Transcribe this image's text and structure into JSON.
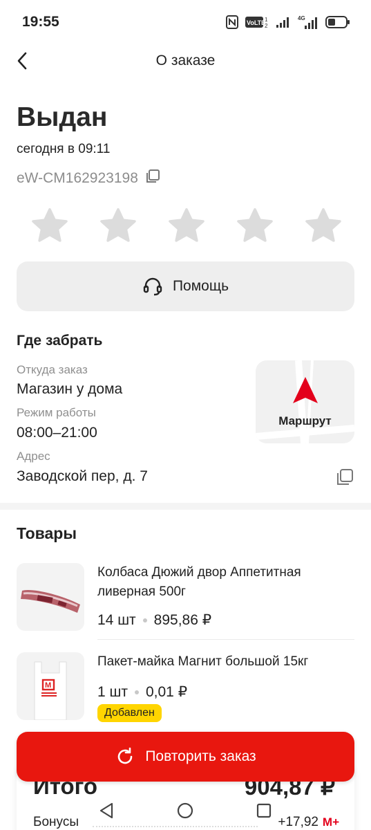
{
  "status_bar": {
    "time": "19:55",
    "icons": [
      "nfc-icon",
      "volte-icon",
      "signal-icon",
      "4g-signal-icon",
      "battery-icon"
    ],
    "volte_text": "VoLTE",
    "network_text": "4G"
  },
  "header": {
    "title": "О заказе",
    "back_icon": "chevron-left-icon"
  },
  "order": {
    "status": "Выдан",
    "date": "сегодня в 09:11",
    "number": "eW-CM162923198",
    "rating_stars": 5,
    "rating_value": 0
  },
  "help": {
    "label": "Помощь",
    "icon": "headset-icon"
  },
  "pickup": {
    "title": "Где забрать",
    "from_label": "Откуда заказ",
    "from_value": "Магазин у дома",
    "hours_label": "Режим работы",
    "hours_value": "08:00–21:00",
    "address_label": "Адрес",
    "address_value": "Заводской пер, д. 7",
    "route_label": "Маршрут"
  },
  "products": {
    "title": "Товары",
    "items": [
      {
        "name": "Колбаса Дюжий двор Аппетитная ливерная 500г",
        "qty": "14 шт",
        "price": "895,86 ₽"
      },
      {
        "name": "Пакет-майка Магнит большой 15кг",
        "qty": "1 шт",
        "price": "0,01 ₽",
        "badge": "Добавлен"
      }
    ]
  },
  "repeat_button": {
    "label": "Повторить заказ",
    "icon": "refresh-icon"
  },
  "total": {
    "label": "Итого",
    "value": "904,87 ₽",
    "bonus_label": "Бонусы",
    "bonus_value": "+17,92",
    "bonus_icon_text": "М+"
  },
  "colors": {
    "accent": "#e8170f",
    "badge": "#ffd500",
    "muted": "#8f8f8f"
  }
}
